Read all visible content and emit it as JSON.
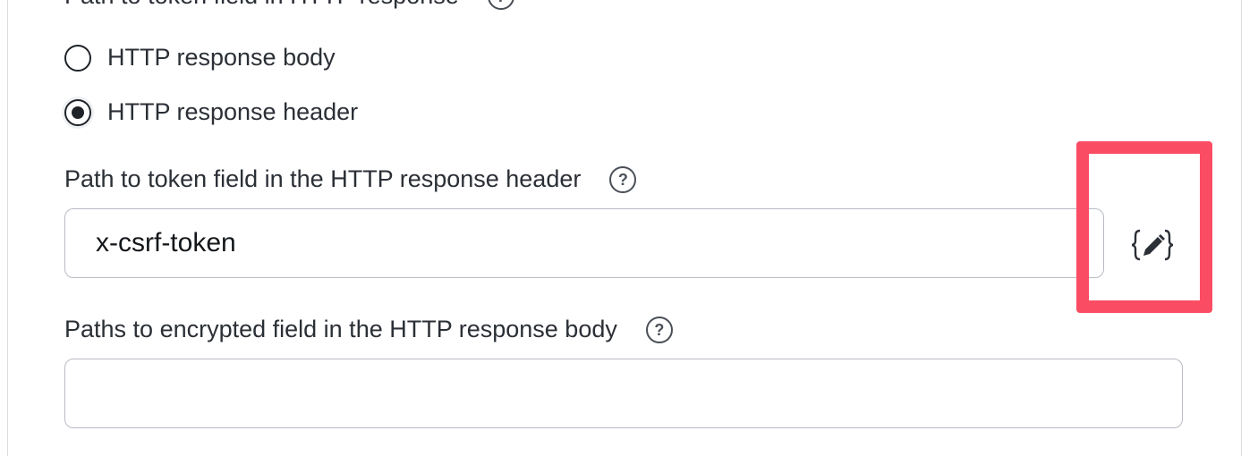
{
  "token_location": {
    "label": "Path to token field in HTTP response",
    "options": [
      {
        "label": "HTTP response body",
        "checked": false
      },
      {
        "label": "HTTP response header",
        "checked": true
      }
    ]
  },
  "header_path": {
    "label": "Path to token field in the HTTP response header",
    "value": "x-csrf-token",
    "variable_button_icon": "curly-braces-pencil-icon"
  },
  "encrypted_paths": {
    "label": "Paths to encrypted field in the HTTP response body",
    "value": ""
  },
  "colors": {
    "highlight": "#fa4d64",
    "input_border": "#b8bcc3",
    "text": "#2b2f36"
  }
}
